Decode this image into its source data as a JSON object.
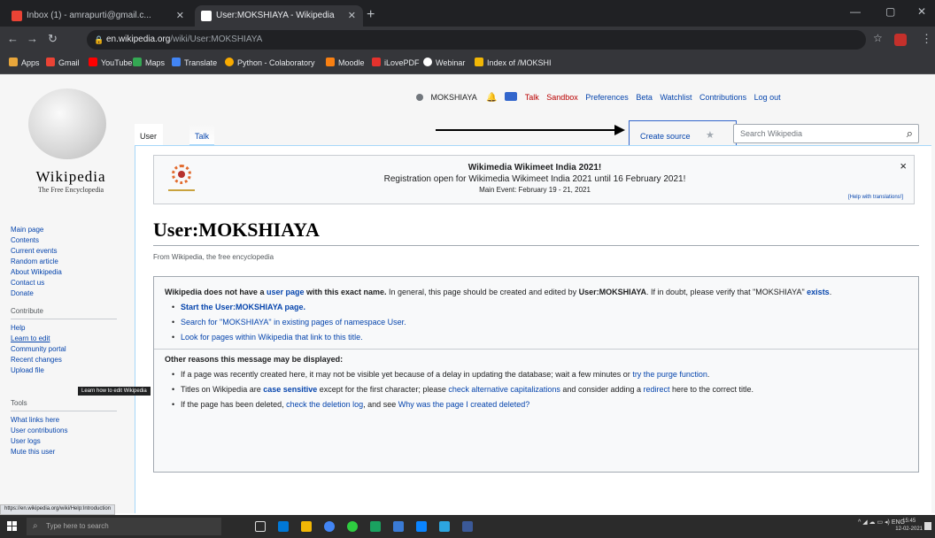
{
  "browser": {
    "tabs": [
      {
        "title": "Inbox (1) - amrapurti@gmail.c...",
        "active": false
      },
      {
        "title": "User:MOKSHIAYA - Wikipedia",
        "active": true
      }
    ],
    "new_tab": "+",
    "url_host": "en.wikipedia.org",
    "url_path": "/wiki/User:MOKSHIAYA",
    "bookmarks": [
      "Apps",
      "Gmail",
      "YouTube",
      "Maps",
      "Translate",
      "Python - Colaboratory",
      "Moodle",
      "iLovePDF",
      "Webinar",
      "Index of /MOKSHI"
    ],
    "colors": {
      "chrome_dark": "#202124",
      "chrome_mid": "#35363a"
    }
  },
  "wiki": {
    "wordmark": "Wikipedia",
    "tagline": "The Free Encyclopedia",
    "personal": {
      "user": "MOKSHIAYA",
      "links": [
        "Talk",
        "Sandbox",
        "Preferences",
        "Beta",
        "Watchlist",
        "Contributions",
        "Log out"
      ]
    },
    "tabs": {
      "user_page": "User page",
      "talk": "Talk"
    },
    "create_source": "Create source",
    "search_placeholder": "Search Wikipedia",
    "notice": {
      "title": "Wikimedia Wikimeet India 2021!",
      "line": "Registration open for Wikimedia Wikimeet India 2021 until 16 February 2021!",
      "sub": "Main Event: February 19 - 21, 2021",
      "help": "[Help with translations!]",
      "close": "×"
    },
    "page_title": "User:MOKSHIAYA",
    "from": "From Wikipedia, the free encyclopedia",
    "noarticle": {
      "intro_bold_1": "Wikipedia does not have a ",
      "intro_link": "user page",
      "intro_bold_2": " with this exact name.",
      "intro_rest": " In general, this page should be created and edited by ",
      "intro_user": "User:MOKSHIAYA",
      "intro_rest2": ". If in doubt, please verify that \"MOKSHIAYA\" ",
      "intro_exists": "exists",
      "items": [
        "Start the User:MOKSHIAYA page.",
        "Search for \"MOKSHIAYA\" in existing pages of namespace User.",
        "Look for pages within Wikipedia that link to this title."
      ],
      "other_heading": "Other reasons this message may be displayed:",
      "reasons": [
        {
          "pre": "If a page was recently created here, it may not be visible yet because of a delay in updating the database; wait a few minutes or ",
          "link": "try the purge function",
          "post": "."
        },
        {
          "pre": "Titles on Wikipedia are ",
          "bold": "case sensitive",
          "mid": " except for the first character; please ",
          "link": "check alternative capitalizations",
          "mid2": " and consider adding a ",
          "link2": "redirect",
          "post": " here to the correct title."
        },
        {
          "pre": "If the page has been deleted, ",
          "link": "check the deletion log",
          "mid": ", and see ",
          "link2": "Why was the page I created deleted?",
          "post": ""
        }
      ]
    },
    "sidebar": {
      "nav": [
        "Main page",
        "Contents",
        "Current events",
        "Random article",
        "About Wikipedia",
        "Contact us",
        "Donate"
      ],
      "contribute_head": "Contribute",
      "contribute": [
        "Help",
        "Learn to edit",
        "Community portal",
        "Recent changes",
        "Upload file"
      ],
      "tools_head": "Tools",
      "tools": [
        "What links here",
        "User contributions",
        "User logs",
        "Mute this user"
      ]
    },
    "tooltip": "Learn how to edit Wikipedia",
    "status_url": "https://en.wikipedia.org/wiki/Help:Introduction"
  },
  "taskbar": {
    "search_placeholder": "Type here to search",
    "tray": "ENG",
    "time": "15:45",
    "date": "12-02-2021"
  }
}
